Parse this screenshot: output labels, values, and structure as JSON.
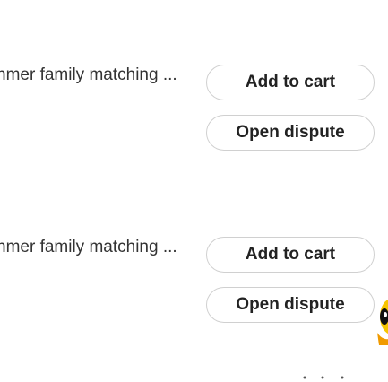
{
  "orders": [
    {
      "title": "nmer family matching ...",
      "add_to_cart_label": "Add to cart",
      "open_dispute_label": "Open dispute"
    },
    {
      "title": "nmer family matching ...",
      "add_to_cart_label": "Add to cart",
      "open_dispute_label": "Open dispute"
    }
  ],
  "colors": {
    "button_border": "#d0d0d0",
    "mascot_yellow": "#f7c500",
    "mascot_orange": "#f09a00"
  },
  "icons": {
    "mascot": "mascot-icon"
  }
}
